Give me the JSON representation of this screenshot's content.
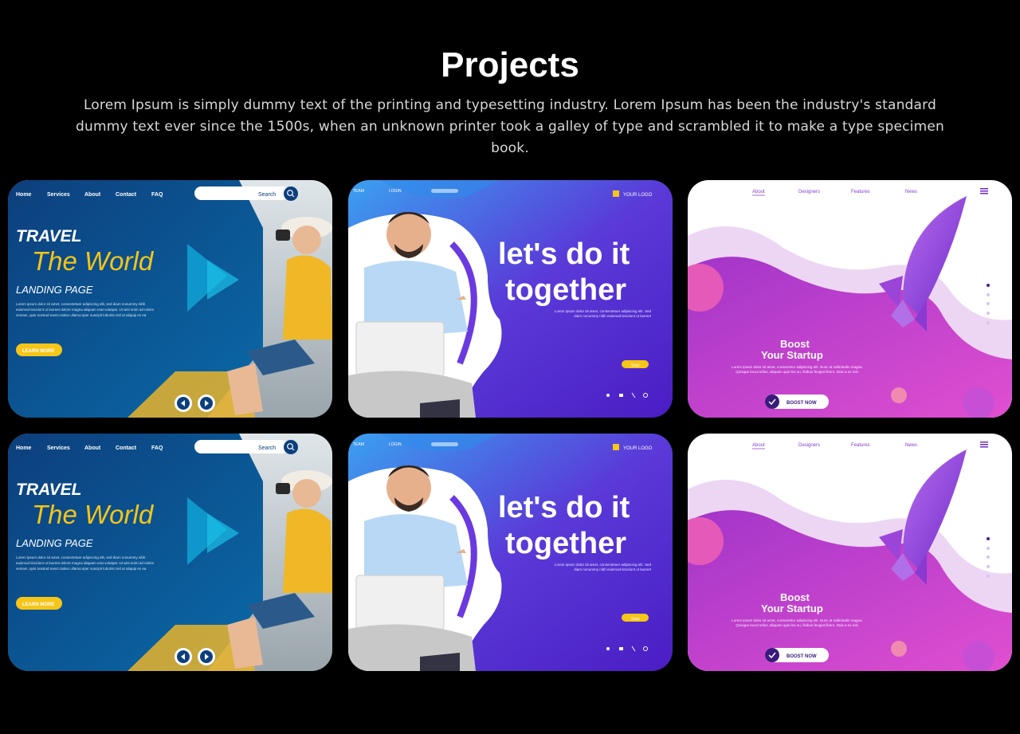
{
  "section": {
    "title": "Projects",
    "description": "Lorem Ipsum is simply dummy text of the printing and typesetting industry. Lorem Ipsum has been the industry's standard dummy text ever since the 1500s, when an unknown printer took a galley of type and scrambled it to make a type specimen book."
  },
  "travel": {
    "nav": [
      "Home",
      "Services",
      "About",
      "Contact",
      "FAQ"
    ],
    "search_placeholder": "Search",
    "heading1": "TRAVEL",
    "heading2": "The World",
    "heading3": "LANDING PAGE",
    "body": "Lorem ipsum dolor sit amet, consectetuer adipiscing elit, sed diam nonummy nibh euismod tincidunt ut laoreet dolore magna aliquam erat volutpat. Ut wisi enim ad minim veniam, quis nostrud exerci tation ullamcorper suscipit lobortis nisl ut aliquip ex ea",
    "cta": "LEARN MORE"
  },
  "together": {
    "nav": [
      "TEAM",
      "LOGIN"
    ],
    "logo": "YOUR LOGO",
    "heading1": "let's do it",
    "heading2": "together",
    "body": "Lorem ipsum dolor sit amet, consectetuer adipiscing elit. Sed diam nonummy nibh euismod tincidunt ut laoreet",
    "cta": "Start"
  },
  "startup": {
    "nav": [
      "About",
      "Designers",
      "Features",
      "News"
    ],
    "heading1": "Boost",
    "heading2": "Your Startup",
    "body": "Lorem ipsum dolor sit amet, consectetur adipiscing elit. Nunc at sollicitudin magna. Quisque lacus tellus, aliquam quis leo eu, finibus feugiat libero. Duis a ex nisl.",
    "cta": "BOOST NOW"
  },
  "colors": {
    "background": "#000000",
    "travel_blue": "#0a4a8c",
    "together_purple": "#5a3ad8",
    "startup_magenta": "#c93fd6",
    "accent_yellow": "#f5c518"
  }
}
